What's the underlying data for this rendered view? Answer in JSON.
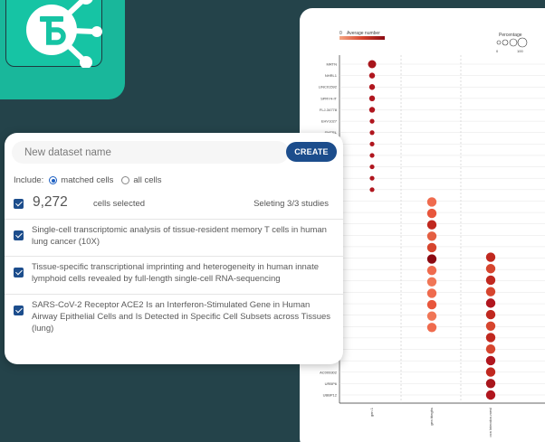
{
  "logo": {
    "icon": "tb-network-logo-icon",
    "arrow": "- - →"
  },
  "dataset": {
    "name_placeholder": "New dataset name",
    "create_label": "CREATE",
    "include_label": "Include:",
    "option_matched": "matched cells",
    "option_all": "all cells",
    "selected_option": "matched cells",
    "cell_count": "9,272",
    "cells_selected_label": "cells selected",
    "studies_label": "Seleting 3/3 studies",
    "studies": [
      {
        "title": "Single-cell transcriptomic analysis of tissue-resident memory T cells in human lung cancer (10X)",
        "checked": true
      },
      {
        "title": "Tissue-specific transcriptional imprinting and heterogeneity in human innate lymphoid cells revealed by full-length single-cell RNA-sequencing",
        "checked": true
      },
      {
        "title": "SARS-CoV-2 Receptor ACE2 Is an Interferon-Stimulated Gene in Human Airway Epithelial Cells and Is Detected in Specific Cell Subsets across Tissues (lung)",
        "checked": true
      }
    ]
  },
  "dotplot": {
    "colorbar_title": "Average number",
    "colorbar_min": "0",
    "size_legend_title": "Percentage",
    "size_legend_min": "0",
    "size_legend_max": "100",
    "colors": {
      "low": "#f4a582",
      "mid": "#d6452e",
      "high": "#8b0a12"
    },
    "gene_labels": [
      "MRTN",
      "NHRL1",
      "LINC01592",
      "SPRY4-IT",
      "FLJ-34778",
      "EHV1027",
      "SMTRL",
      "",
      "",
      "",
      "",
      "",
      "",
      "",
      "",
      "",
      "",
      "",
      "",
      "",
      "",
      "",
      "",
      "",
      "",
      "",
      "LY1",
      "AC009302",
      "URBP6",
      "UBBP12"
    ],
    "column_labels": [
      "gen 1",
      "gen ttteghs",
      "ocn lnteodcn-mesl"
    ]
  }
}
